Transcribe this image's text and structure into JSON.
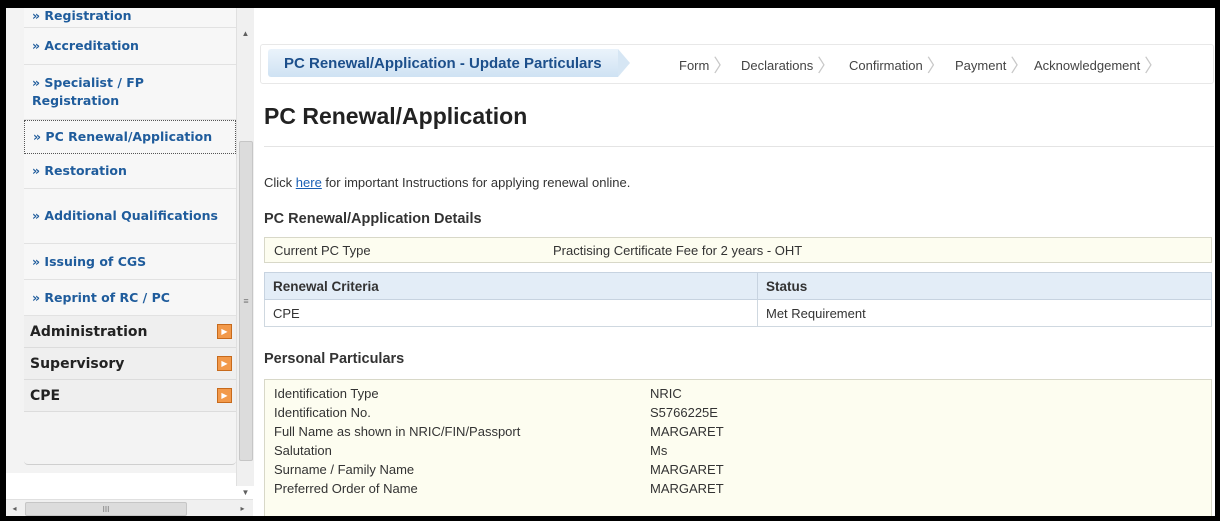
{
  "sidebar": {
    "sub_items": [
      {
        "label": "» Registration"
      },
      {
        "label": "» Accreditation"
      },
      {
        "label": "» Specialist / FP Registration"
      },
      {
        "label": "» PC Renewal/Application"
      },
      {
        "label": "» Restoration"
      },
      {
        "label": "» Additional Qualifications"
      },
      {
        "label": "» Issuing of CGS"
      },
      {
        "label": "» Reprint of RC / PC"
      }
    ],
    "categories": [
      {
        "label": "Administration"
      },
      {
        "label": "Supervisory"
      },
      {
        "label": "CPE"
      }
    ]
  },
  "wizard": {
    "current": "PC Renewal/Application - Update Particulars",
    "steps": [
      "Form",
      "Declarations",
      "Confirmation",
      "Payment",
      "Acknowledgement"
    ]
  },
  "page": {
    "title": "PC Renewal/Application",
    "instructions_pre": "Click ",
    "instructions_link": "here",
    "instructions_post": " for important Instructions for applying renewal online."
  },
  "details": {
    "section_title": "PC Renewal/Application Details",
    "pc_type_label": "Current PC Type",
    "pc_type_value": "Practising Certificate Fee for 2 years - OHT",
    "criteria_headers": [
      "Renewal Criteria",
      "Status"
    ],
    "criteria_rows": [
      {
        "criteria": "CPE",
        "status": "Met Requirement"
      }
    ]
  },
  "personal": {
    "section_title": "Personal Particulars",
    "rows": [
      {
        "label": "Identification Type",
        "value": "NRIC"
      },
      {
        "label": "Identification No.",
        "value": "S5766225E"
      },
      {
        "label": "Full Name as shown in NRIC/FIN/Passport",
        "value": "MARGARET"
      },
      {
        "label": "Salutation",
        "value": "Ms"
      },
      {
        "label": "Surname / Family Name",
        "value": "MARGARET"
      },
      {
        "label": "Preferred Order of Name",
        "value": "MARGARET"
      }
    ]
  },
  "scrollbar": {
    "up_glyph": "▲",
    "down_glyph": "▼",
    "grip_glyph": "≡",
    "left_glyph": "◂",
    "right_glyph": "▸",
    "hgrip_glyph": "III"
  }
}
